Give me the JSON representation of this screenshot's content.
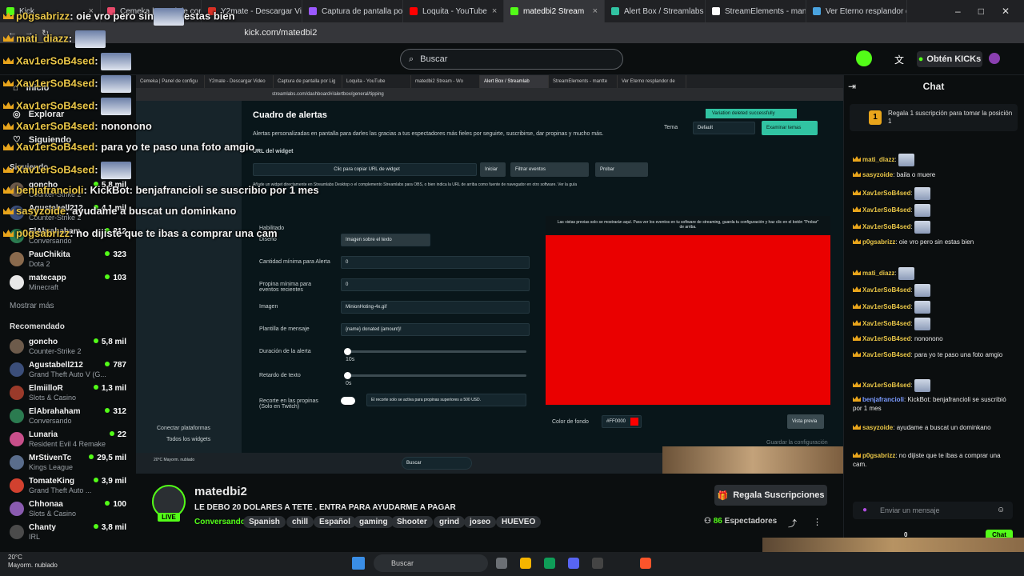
{
  "browser": {
    "tabs": [
      {
        "label": "Kick",
        "color": "#53fc18"
      },
      {
        "label": "Cemeka | Panel de config",
        "color": "#e94a6b"
      },
      {
        "label": "Y2mate - Descargar Video",
        "color": "#d93025"
      },
      {
        "label": "Captura de pantalla por Lig",
        "color": "#9b59ff"
      },
      {
        "label": "Loquita - YouTube",
        "color": "#ff0000"
      },
      {
        "label": "matedbi2 Stream",
        "color": "#53fc18"
      },
      {
        "label": "Alert Box / Streamlabs",
        "color": "#31c3a2"
      },
      {
        "label": "StreamElements - mantte",
        "color": "#ffffff"
      },
      {
        "label": "Ver Eterno resplandor de",
        "color": "#4aa3df"
      }
    ],
    "active_tab_index": 5,
    "url": "kick.com/matedbi2",
    "window_controls": [
      "–",
      "□",
      "✕"
    ]
  },
  "kick": {
    "search_placeholder": "Buscar",
    "kicks_button": "Obtén KICKs",
    "nav": [
      {
        "label": "Inicio",
        "icon": "home-icon"
      },
      {
        "label": "Explorar",
        "icon": "compass-icon"
      },
      {
        "label": "Siguiendo",
        "icon": "heart-icon"
      }
    ],
    "following_title": "Siguiendo",
    "following": [
      {
        "name": "goncho",
        "game": "Counter-Strike 2",
        "viewers": "5,8 mil",
        "color": "#6d5b4b"
      },
      {
        "name": "Agustabell212",
        "game": "Counter-Strike 2",
        "viewers": "4,1 mil",
        "color": "#3b4e7a"
      },
      {
        "name": "ElAbrahaham",
        "game": "Conversando",
        "viewers": "312",
        "color": "#2b7b50"
      },
      {
        "name": "PauChikita",
        "game": "Dota 2",
        "viewers": "323",
        "color": "#8a6a4d"
      },
      {
        "name": "matecapp",
        "game": "Minecraft",
        "viewers": "103",
        "color": "#e8e8e8"
      }
    ],
    "show_more": "Mostrar más",
    "recommended_title": "Recomendado",
    "recommended": [
      {
        "name": "goncho",
        "game": "Counter-Strike 2",
        "viewers": "5,8 mil",
        "color": "#6d5b4b"
      },
      {
        "name": "Agustabell212",
        "game": "Grand Theft Auto V (G...",
        "viewers": "787",
        "color": "#3b4e7a"
      },
      {
        "name": "ElmiilloR",
        "game": "Slots & Casino",
        "viewers": "1,3 mil",
        "color": "#9a3a2a"
      },
      {
        "name": "ElAbrahaham",
        "game": "Conversando",
        "viewers": "312",
        "color": "#2b7b50"
      },
      {
        "name": "Lunaria",
        "game": "Resident Evil 4 Remake",
        "viewers": "22",
        "color": "#c84f8a"
      },
      {
        "name": "MrStivenTc",
        "game": "Kings League",
        "viewers": "29,5 mil",
        "color": "#5a6d8c"
      },
      {
        "name": "TomateKing",
        "game": "Grand Theft Auto ...",
        "viewers": "3,9 mil",
        "color": "#d2412f"
      },
      {
        "name": "Chhonaa",
        "game": "Slots & Casino",
        "viewers": "100",
        "color": "#8a5bb0"
      },
      {
        "name": "Chanty",
        "game": "IRL",
        "viewers": "3,8 mil",
        "color": "#4b4b4b"
      }
    ]
  },
  "overlay_chat": [
    {
      "user": "p0gsabrizz",
      "text": "oie vro pero sin",
      "tail": "estas bien"
    },
    {
      "user": "mati_diazz",
      "text": ""
    },
    {
      "user": "Xav1erSoB4sed",
      "text": ""
    },
    {
      "user": "Xav1erSoB4sed",
      "text": ""
    },
    {
      "user": "Xav1erSoB4sed",
      "text": ""
    },
    {
      "user": "Xav1erSoB4sed",
      "text": "nononono"
    },
    {
      "user": "Xav1erSoB4sed",
      "text": "para yo te paso una foto amgio"
    },
    {
      "user": "Xav1erSoB4sed",
      "text": ""
    },
    {
      "user": "benjafrancioli",
      "text": "KickBot: benjafrancioli se suscribio por 1 mes"
    },
    {
      "user": "sasyzoide",
      "text": "ayudame a buscat un dominkano"
    },
    {
      "user": "p0gsabrizz",
      "text": "no dijiste que te ibas a comprar una cam"
    }
  ],
  "streamlabs": {
    "inner_tabs": [
      "Cemeka | Panel de configu",
      "Y2mate - Descargar Video",
      "Captura de pantalla por Lig",
      "Loquita - YouTube",
      "matedbi2 Stream - Wo",
      "Alert Box / Streamlab",
      "StreamElements - mantte",
      "Ver Eterno resplandor de"
    ],
    "inner_url": "streamlabs.com/dashboard#/alertbox/general/tipping",
    "heading": "Cuadro de alertas",
    "description": "Alertas personalizadas en pantalla para darles las gracias a tus espectadores más fieles por seguirte, suscribirse, dar propinas y mucho más.",
    "theme_label": "Tema",
    "theme_value": "Default",
    "explore_themes": "Examinar temas",
    "toast": "Variation deleted successfully",
    "widget_url_label": "URL del widget",
    "copy_url": "Clic para copiar URL de widget",
    "btn_start": "Iniciar",
    "filter_events": "Filtrar eventos",
    "btn_test": "Probar",
    "help_text": "Añade un widget directamente en Streamlabs Desktop o el complemento Streamlabs para OBS, o bien indica la URL de arriba como fuente de navegador en otro software. Ver la guía",
    "enabled_label": "Habilitado",
    "preview_note": "Las vistas previas solo se mostrarán aquí. Para ver los eventos en tu software de streaming, guarda tu configuración y haz clic en el botón \"Probar\" de arriba.",
    "fields": [
      {
        "label": "Diseño",
        "value": "Imagen sobre el texto"
      },
      {
        "label": "Cantidad mínima para Alerta",
        "value": "0"
      },
      {
        "label": "Propina mínima para eventos recientes",
        "value": "0"
      },
      {
        "label": "Imagen",
        "value": "MinionHoting-4x.gif"
      },
      {
        "label": "Plantilla de mensaje",
        "value": "{name} donated {amount}!"
      },
      {
        "label": "Duración de la alerta",
        "value": "10s"
      },
      {
        "label": "Retardo de texto",
        "value": "0s"
      },
      {
        "label": "Recorte en las propinas (Solo en Twitch)",
        "value": "El recorte solo se activa para propinas superiores a 500 USD."
      }
    ],
    "bg_color_label": "Color de fondo",
    "bg_color_value": "#FF0000",
    "preview_button": "Vista previa",
    "save_button": "Guardar la configuración",
    "side_links": [
      "Conectar plataformas",
      "Todos los widgets"
    ],
    "inner_weather": "20°C Mayorm. nublado",
    "inner_search": "Buscar"
  },
  "channel": {
    "name": "matedbi2",
    "live": "LIVE",
    "title": "LE DEBO 20 DOLARES A TETE . ENTRA PARA AYUDARME A PAGAR",
    "category": "Conversando",
    "tags": [
      "Spanish",
      "chill",
      "Español",
      "gaming",
      "Shooter",
      "grind",
      "joseo",
      "HUEVEO"
    ],
    "sub_button": "Regala Suscripciones",
    "viewers": "86",
    "viewers_label": "Espectadores"
  },
  "chat": {
    "title": "Chat",
    "pinned": "Regala 1 suscripción para tomar la posición 1",
    "messages": [
      {
        "user": "mati_diazz",
        "text": "",
        "cls": "n1"
      },
      {
        "user": "sasyzoide",
        "text": "baila o muere",
        "cls": "n1"
      },
      {
        "user": "Xav1erSoB4sed",
        "text": "",
        "cls": "n1"
      },
      {
        "user": "Xav1erSoB4sed",
        "text": "",
        "cls": "n1"
      },
      {
        "user": "Xav1erSoB4sed",
        "text": "",
        "cls": "n1"
      },
      {
        "user": "p0gsabrizz",
        "text": "oie vro pero sin estas bien",
        "cls": "n1"
      },
      {
        "user": "mati_diazz",
        "text": "",
        "cls": "n1"
      },
      {
        "user": "Xav1erSoB4sed",
        "text": "",
        "cls": "n1"
      },
      {
        "user": "Xav1erSoB4sed",
        "text": "",
        "cls": "n1"
      },
      {
        "user": "Xav1erSoB4sed",
        "text": "",
        "cls": "n1"
      },
      {
        "user": "Xav1erSoB4sed",
        "text": "nononono",
        "cls": "n1"
      },
      {
        "user": "Xav1erSoB4sed",
        "text": "para yo te paso una foto amgio",
        "cls": "n1"
      },
      {
        "user": "Xav1erSoB4sed",
        "text": "",
        "cls": "n1"
      },
      {
        "user": "benjafrancioli",
        "text": "KickBot: benjafrancioli se suscribió por 1 mes",
        "cls": "n2"
      },
      {
        "user": "sasyzoide",
        "text": "ayudame a buscat un dominkano",
        "cls": "n1"
      },
      {
        "user": "p0gsabrizz",
        "text": "no dijiste que te ibas a comprar una cam.",
        "cls": "n1"
      }
    ],
    "input_placeholder": "Enviar un mensaje",
    "send_button": "Chat",
    "footer_count": "0"
  },
  "taskbar": {
    "temp": "20°C",
    "weather": "Mayorm. nublado",
    "search": "Buscar"
  }
}
